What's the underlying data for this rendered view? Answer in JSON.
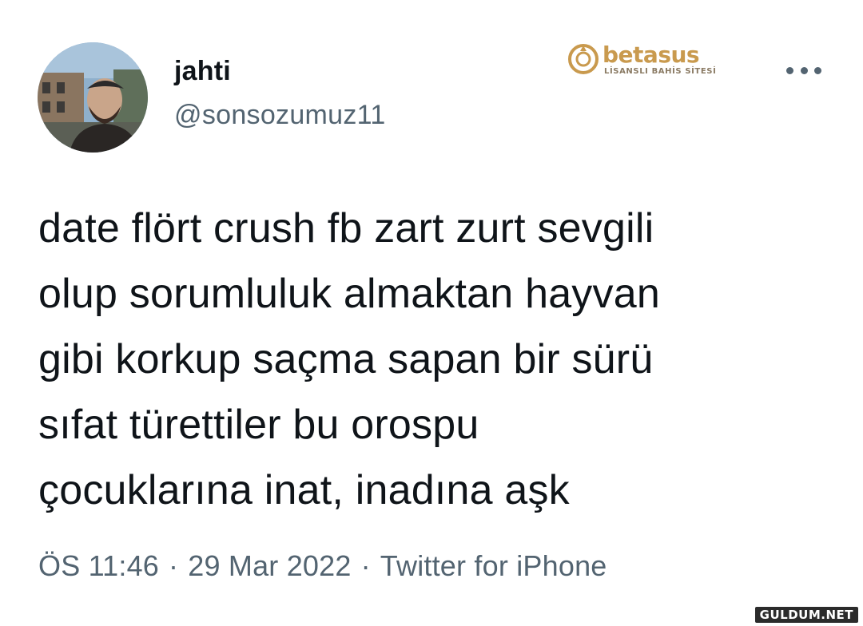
{
  "author": {
    "display_name": "jahti",
    "handle": "@sonsozumuz11"
  },
  "tweet": {
    "text": "date flört crush fb zart zurt sevgili\nolup sorumluluk almaktan hayvan\ngibi korkup saçma sapan bir sürü\nsıfat türettiler bu orospu\nçocuklarına inat, inadına aşk",
    "time": "ÖS 11:46",
    "date": "29 Mar 2022",
    "source": "Twitter for iPhone",
    "separator": "·"
  },
  "overlay_logo": {
    "name": "betasus",
    "tagline": "LİSANSLI BAHİS SİTESİ",
    "color": "#c99a4e"
  },
  "watermark": {
    "text": "GULDUM.NET"
  },
  "icons": {
    "more": "more-horizontal-icon"
  },
  "colors": {
    "text_primary": "#0f1419",
    "text_secondary": "#536471",
    "background": "#ffffff"
  }
}
